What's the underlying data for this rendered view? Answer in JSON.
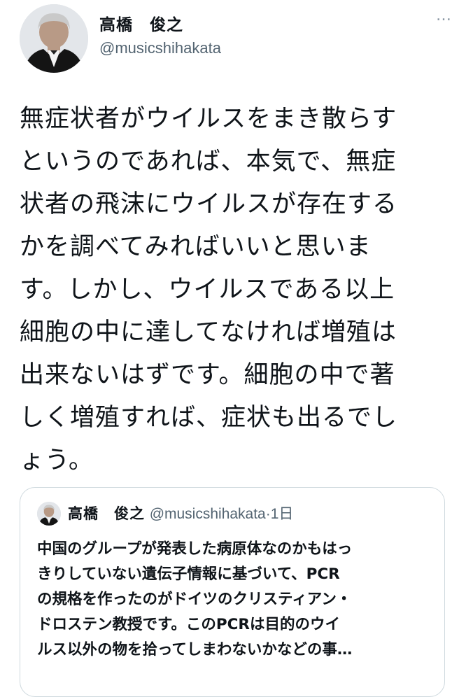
{
  "author": {
    "display_name": "高橋　俊之",
    "handle": "@musicshihakata",
    "avatar_icon": "conductor-photo-avatar"
  },
  "more_icon": "…",
  "tweet": {
    "text": "無症状者がウイルスをまき散らす\nというのであれば、本気で、無症\n状者の飛沫にウイルスが存在する\nかを調べてみればいいと思いま\nす。しかし、ウイルスである以上\n細胞の中に達してなければ増殖は\n出来ないはずです。細胞の中で著\nしく増殖すれば、症状も出るでし\nょう。"
  },
  "quoted_tweet": {
    "display_name": "高橋　俊之",
    "handle": "@musicshihakata",
    "separator": "·",
    "time": "1日",
    "text": "中国のグループが発表した病原体なのかもはっ\nきりしていない遺伝子情報に基づいて、PCR\nの規格を作ったのがドイツのクリスティアン・\nドロステン教授です。このPCRは目的のウイ\nルス以外の物を拾ってしまわないかなどの事…"
  },
  "colors": {
    "text_primary": "#0f1419",
    "text_secondary": "#536471",
    "border": "#cfd9de"
  }
}
